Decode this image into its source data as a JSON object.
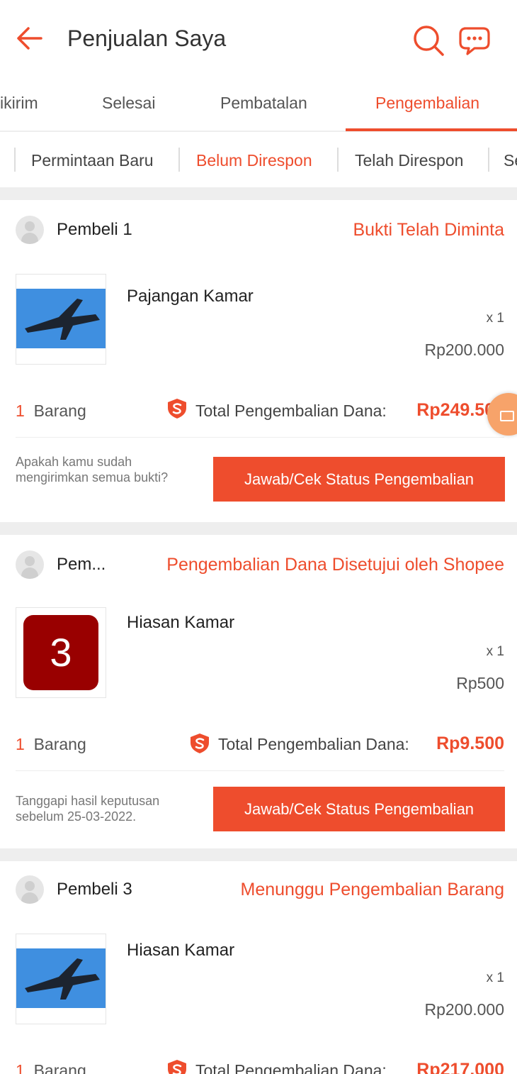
{
  "header": {
    "title": "Penjualan Saya",
    "back_icon": "arrow-left-icon",
    "search_icon": "search-icon",
    "chat_icon": "chat-icon"
  },
  "tabs": [
    {
      "label": "ikirim",
      "active": false
    },
    {
      "label": "Selesai",
      "active": false
    },
    {
      "label": "Pembatalan",
      "active": false
    },
    {
      "label": "Pengembalian",
      "active": true
    }
  ],
  "subtabs": [
    {
      "label": "Permintaan Baru",
      "active": false
    },
    {
      "label": "Belum Direspon",
      "active": true
    },
    {
      "label": "Telah Direspon",
      "active": false
    },
    {
      "label": "Se",
      "active": false
    }
  ],
  "orders": [
    {
      "buyer": "Pembeli 1",
      "status": "Bukti Telah Diminta",
      "product": "Pajangan Kamar",
      "thumbnail": "airplane-photo",
      "qty": "x 1",
      "price": "Rp200.000",
      "count_num": "1",
      "count_label": "Barang",
      "total_label": "Total Pengembalian Dana:",
      "total_value": "Rp249.500",
      "note": "Apakah kamu sudah mengirimkan semua bukti?",
      "button": "Jawab/Cek Status Pengembalian"
    },
    {
      "buyer": "Pem...",
      "status": "Pengembalian Dana Disetujui oleh Shopee",
      "product": "Hiasan Kamar",
      "thumbnail_text": "3",
      "qty": "x 1",
      "price": "Rp500",
      "count_num": "1",
      "count_label": "Barang",
      "total_label": "Total Pengembalian Dana:",
      "total_value": "Rp9.500",
      "note": "Tanggapi hasil keputusan sebelum 25-03-2022.",
      "button": "Jawab/Cek Status Pengembalian"
    },
    {
      "buyer": "Pembeli 3",
      "status": "Menunggu Pengembalian Barang",
      "product": "Hiasan Kamar",
      "thumbnail": "airplane-photo",
      "qty": "x 1",
      "price": "Rp200.000",
      "count_num": "1",
      "count_label": "Barang",
      "total_label": "Total Pengembalian Dana:",
      "total_value": "Rp217.000"
    }
  ],
  "colors": {
    "accent": "#ee4d2d",
    "background_gap": "#eeeeee"
  }
}
